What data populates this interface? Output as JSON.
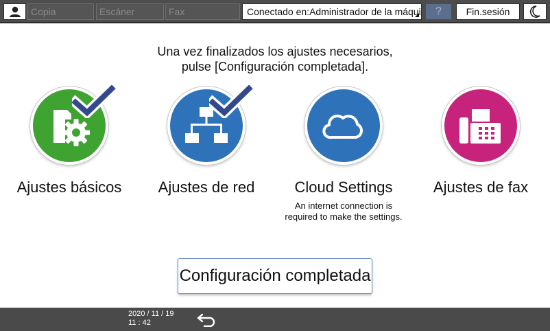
{
  "topbar": {
    "apps": [
      "Copia",
      "Escáner",
      "Fax"
    ],
    "connected": "Conectado en:Administrador de la máquina",
    "help": "?",
    "logout": "Fin.sesión"
  },
  "instruction": {
    "line1": "Una vez finalizados los ajustes necesarios,",
    "line2": "pulse [Configuración completada]."
  },
  "tiles": [
    {
      "label": "Ajustes básicos",
      "icon": "machine-gear-icon",
      "color": "#3fa332",
      "completed": true
    },
    {
      "label": "Ajustes de red",
      "icon": "network-icon",
      "color": "#2e73b9",
      "completed": true
    },
    {
      "label": "Cloud Settings",
      "icon": "cloud-icon",
      "color": "#2e73b9",
      "completed": false,
      "note_line1": "An internet connection is",
      "note_line2": "required to make the settings."
    },
    {
      "label": "Ajustes de fax",
      "icon": "fax-icon",
      "color": "#c8237c",
      "completed": false
    }
  ],
  "done_button": "Configuración completada",
  "footer": {
    "date": "2020 / 11 / 19",
    "time": "11 : 42",
    "back_icon": "back-arrow-icon"
  }
}
